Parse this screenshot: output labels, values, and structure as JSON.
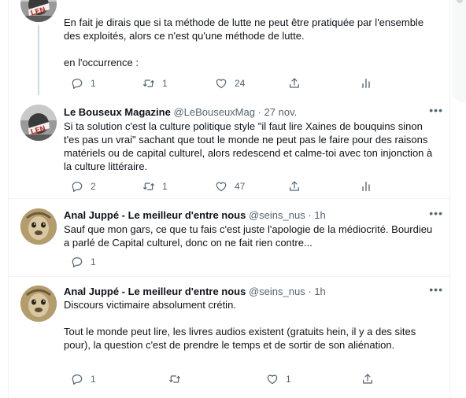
{
  "tweets": [
    {
      "name": "",
      "handle": "",
      "time": "",
      "text": "En fait je dirais que si ta méthode de lutte ne peut être pratiquée par l'ensemble des exploités, alors ce n'est qu'une méthode de lutte.\n\nen l'occurrence :",
      "replies": "1",
      "retweets": "1",
      "likes": "24"
    },
    {
      "name": "Le Bouseux Magazine",
      "handle": "@LeBouseuxMag",
      "time": "27 nov.",
      "text": "Si ta solution c'est la culture politique style \"il faut lire Xaines de bouquins sinon t'es pas un vrai\" sachant que tout le monde ne peut pas le faire pour des raisons matériels ou de capital culturel, alors redescend et calme-toi avec ton injonction à la culture littéraire.",
      "replies": "2",
      "retweets": "1",
      "likes": "47"
    },
    {
      "name": "Anal Juppé - Le meilleur d'entre nous",
      "handle": "@seins_nus",
      "time": "1h",
      "text": "Sauf que mon gars, ce que tu fais c'est juste l'apologie de la médiocrité. Bourdieu a parlé de Capital culturel, donc on ne fait rien contre...",
      "replies": "1",
      "retweets": "",
      "likes": ""
    },
    {
      "name": "Anal Juppé - Le meilleur d'entre nous",
      "handle": "@seins_nus",
      "time": "1h",
      "text": "Discours victimaire absolument crétin.\n\nTout le monde peut lire, les livres audios existent (gratuits hein, il y a des sites pour), la question c'est de prendre le temps et de sortir de son aliénation.",
      "replies": "1",
      "retweets": "",
      "likes": "1"
    }
  ],
  "separator": "·",
  "icons": [
    "reply-icon",
    "retweet-icon",
    "like-icon",
    "share-icon",
    "analytics-icon",
    "more-icon"
  ],
  "colors": {
    "text": "#0f1419",
    "secondary": "#536471",
    "border": "#eff3f4"
  }
}
